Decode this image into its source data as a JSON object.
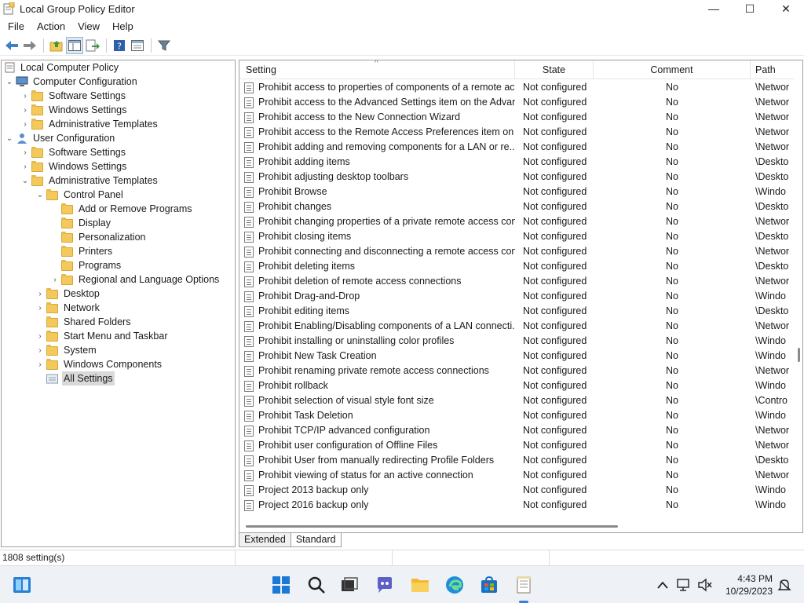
{
  "window": {
    "title": "Local Group Policy Editor",
    "controls": {
      "minimize": "—",
      "maximize": "☐",
      "close": "✕"
    }
  },
  "menu": [
    "File",
    "Action",
    "View",
    "Help"
  ],
  "toolbar": {
    "buttons": [
      "back-icon",
      "forward-icon",
      "up-folder-icon",
      "show-hide-tree-icon",
      "export-list-icon",
      "help-icon",
      "properties-icon",
      "filter-icon"
    ]
  },
  "tree": {
    "root": "Local Computer Policy",
    "computer_config": "Computer Configuration",
    "cc_software": "Software Settings",
    "cc_windows": "Windows Settings",
    "cc_admin": "Administrative Templates",
    "user_config": "User Configuration",
    "uc_software": "Software Settings",
    "uc_windows": "Windows Settings",
    "uc_admin": "Administrative Templates",
    "control_panel": "Control Panel",
    "add_remove": "Add or Remove Programs",
    "display": "Display",
    "personalization": "Personalization",
    "printers": "Printers",
    "programs": "Programs",
    "regional": "Regional and Language Options",
    "desktop": "Desktop",
    "network": "Network",
    "shared_folders": "Shared Folders",
    "start_menu": "Start Menu and Taskbar",
    "system": "System",
    "windows_components": "Windows Components",
    "all_settings": "All Settings"
  },
  "list": {
    "columns": {
      "setting": "Setting",
      "state": "State",
      "comment": "Comment",
      "path": "Path"
    },
    "rows": [
      {
        "setting": "Prohibit access to properties of components of a remote ac...",
        "state": "Not configured",
        "comment": "No",
        "path": "\\Networ"
      },
      {
        "setting": "Prohibit access to the Advanced Settings item on the Advan...",
        "state": "Not configured",
        "comment": "No",
        "path": "\\Networ"
      },
      {
        "setting": "Prohibit access to the New Connection Wizard",
        "state": "Not configured",
        "comment": "No",
        "path": "\\Networ"
      },
      {
        "setting": "Prohibit access to the Remote Access Preferences item on t...",
        "state": "Not configured",
        "comment": "No",
        "path": "\\Networ"
      },
      {
        "setting": "Prohibit adding and removing components for a LAN or re...",
        "state": "Not configured",
        "comment": "No",
        "path": "\\Networ"
      },
      {
        "setting": "Prohibit adding items",
        "state": "Not configured",
        "comment": "No",
        "path": "\\Deskto"
      },
      {
        "setting": "Prohibit adjusting desktop toolbars",
        "state": "Not configured",
        "comment": "No",
        "path": "\\Deskto"
      },
      {
        "setting": "Prohibit Browse",
        "state": "Not configured",
        "comment": "No",
        "path": "\\Windo"
      },
      {
        "setting": "Prohibit changes",
        "state": "Not configured",
        "comment": "No",
        "path": "\\Deskto"
      },
      {
        "setting": "Prohibit changing properties of a private remote access con...",
        "state": "Not configured",
        "comment": "No",
        "path": "\\Networ"
      },
      {
        "setting": "Prohibit closing items",
        "state": "Not configured",
        "comment": "No",
        "path": "\\Deskto"
      },
      {
        "setting": "Prohibit connecting and disconnecting a remote access con...",
        "state": "Not configured",
        "comment": "No",
        "path": "\\Networ"
      },
      {
        "setting": "Prohibit deleting items",
        "state": "Not configured",
        "comment": "No",
        "path": "\\Deskto"
      },
      {
        "setting": "Prohibit deletion of remote access connections",
        "state": "Not configured",
        "comment": "No",
        "path": "\\Networ"
      },
      {
        "setting": "Prohibit Drag-and-Drop",
        "state": "Not configured",
        "comment": "No",
        "path": "\\Windo"
      },
      {
        "setting": "Prohibit editing items",
        "state": "Not configured",
        "comment": "No",
        "path": "\\Deskto"
      },
      {
        "setting": "Prohibit Enabling/Disabling components of a LAN connecti...",
        "state": "Not configured",
        "comment": "No",
        "path": "\\Networ"
      },
      {
        "setting": "Prohibit installing or uninstalling color profiles",
        "state": "Not configured",
        "comment": "No",
        "path": "\\Windo"
      },
      {
        "setting": "Prohibit New Task Creation",
        "state": "Not configured",
        "comment": "No",
        "path": "\\Windo"
      },
      {
        "setting": "Prohibit renaming private remote access connections",
        "state": "Not configured",
        "comment": "No",
        "path": "\\Networ"
      },
      {
        "setting": "Prohibit rollback",
        "state": "Not configured",
        "comment": "No",
        "path": "\\Windo"
      },
      {
        "setting": "Prohibit selection of visual style font size",
        "state": "Not configured",
        "comment": "No",
        "path": "\\Contro"
      },
      {
        "setting": "Prohibit Task Deletion",
        "state": "Not configured",
        "comment": "No",
        "path": "\\Windo"
      },
      {
        "setting": "Prohibit TCP/IP advanced configuration",
        "state": "Not configured",
        "comment": "No",
        "path": "\\Networ"
      },
      {
        "setting": "Prohibit user configuration of Offline Files",
        "state": "Not configured",
        "comment": "No",
        "path": "\\Networ"
      },
      {
        "setting": "Prohibit User from manually redirecting Profile Folders",
        "state": "Not configured",
        "comment": "No",
        "path": "\\Deskto"
      },
      {
        "setting": "Prohibit viewing of status for an active connection",
        "state": "Not configured",
        "comment": "No",
        "path": "\\Networ"
      },
      {
        "setting": "Project 2013 backup only",
        "state": "Not configured",
        "comment": "No",
        "path": "\\Windo"
      },
      {
        "setting": "Project 2016 backup only",
        "state": "Not configured",
        "comment": "No",
        "path": "\\Windo"
      }
    ]
  },
  "tabs": {
    "extended": "Extended",
    "standard": "Standard"
  },
  "status": {
    "text": "1808 setting(s)"
  },
  "taskbar": {
    "icons": [
      "widgets-icon",
      "start-icon",
      "search-icon",
      "task-view-icon",
      "chat-icon",
      "file-explorer-icon",
      "edge-icon",
      "store-icon",
      "gpedit-icon"
    ],
    "tray": [
      "chevron-up-icon",
      "network-icon",
      "volume-icon",
      "notification-icon"
    ],
    "time": "4:43 PM",
    "date": "10/29/2023"
  },
  "colors": {
    "accent": "#0078d4",
    "folder": "#f3c95c",
    "selection": "#d9d9d9",
    "taskbar": "#eef2f7"
  }
}
